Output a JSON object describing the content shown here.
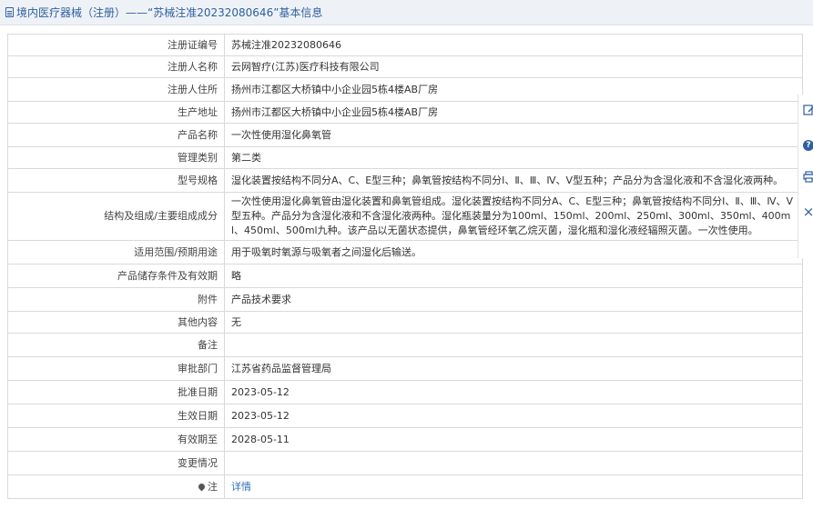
{
  "header": {
    "title": "境内医疗器械（注册）——“苏械注准20232080646”基本信息"
  },
  "rows": [
    {
      "label": "注册证编号",
      "value": "苏械注准20232080646"
    },
    {
      "label": "注册人名称",
      "value": "云网智疗(江苏)医疗科技有限公司"
    },
    {
      "label": "注册人住所",
      "value": "扬州市江都区大桥镇中小企业园5栋4楼AB厂房"
    },
    {
      "label": "生产地址",
      "value": "扬州市江都区大桥镇中小企业园5栋4楼AB厂房"
    },
    {
      "label": "产品名称",
      "value": "一次性使用湿化鼻氧管"
    },
    {
      "label": "管理类别",
      "value": "第二类"
    },
    {
      "label": "型号规格",
      "value": "湿化装置按结构不同分A、C、E型三种；鼻氧管按结构不同分Ⅰ、Ⅱ、Ⅲ、Ⅳ、Ⅴ型五种；产品分为含湿化液和不含湿化液两种。"
    },
    {
      "label": "结构及组成/主要组成成分",
      "value": "一次性使用湿化鼻氧管由湿化装置和鼻氧管组成。湿化装置按结构不同分A、C、E型三种；鼻氧管按结构不同分Ⅰ、Ⅱ、Ⅲ、Ⅳ、Ⅴ型五种。产品分为含湿化液和不含湿化液两种。湿化瓶装量分为100ml、150ml、200ml、250ml、300ml、350ml、400ml、450ml、500ml九种。该产品以无菌状态提供，鼻氧管经环氧乙烷灭菌，湿化瓶和湿化液经辐照灭菌。一次性使用。"
    },
    {
      "label": "适用范围/预期用途",
      "value": "用于吸氧时氧源与吸氧者之间湿化后输送。"
    },
    {
      "label": "产品储存条件及有效期",
      "value": "略"
    },
    {
      "label": "附件",
      "value": "产品技术要求"
    },
    {
      "label": "其他内容",
      "value": "无"
    },
    {
      "label": "备注",
      "value": ""
    },
    {
      "label": "审批部门",
      "value": "江苏省药品监督管理局"
    },
    {
      "label": "批准日期",
      "value": "2023-05-12"
    },
    {
      "label": "生效日期",
      "value": "2023-05-12"
    },
    {
      "label": "有效期至",
      "value": "2028-05-11"
    },
    {
      "label": "变更情况",
      "value": ""
    }
  ],
  "note": {
    "label": "注",
    "link": "详情"
  },
  "toolbar": {
    "edit_icon": "edit-icon",
    "help_icon": "help-icon",
    "print_icon": "print-icon",
    "close_icon": "close-icon",
    "help_glyph": "?",
    "close_glyph": "×"
  }
}
